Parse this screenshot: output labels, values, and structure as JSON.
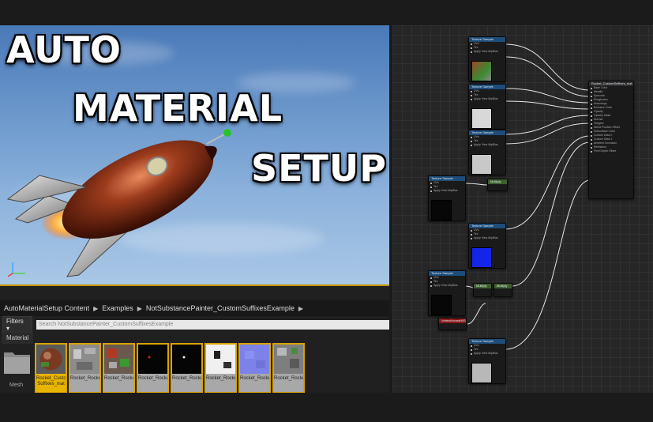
{
  "title_lines": [
    "AUTO",
    "MATERIAL",
    "SETUP"
  ],
  "breadcrumb": [
    "AutoMaterialSetup Content",
    "Examples",
    "NotSubstancePainter_CustomSuffixesExample"
  ],
  "filters_label": "Filters",
  "search_placeholder": "Search NotSubstancePainter_CustomSuffixesExample",
  "filter_category": "Material",
  "folder_label": "Mesh",
  "assets": [
    {
      "label": "Rocket_Custom Suffixes_mat",
      "thumb": "sphere-material",
      "selected": true
    },
    {
      "label": "Rocket_Rocket_mat_ao",
      "thumb": "grey-noise"
    },
    {
      "label": "Rocket_Rocket_mat_DIFF",
      "thumb": "diffuse"
    },
    {
      "label": "Rocket_Rocket_mat_e",
      "thumb": "black-red"
    },
    {
      "label": "Rocket_Rocket_mat_height",
      "thumb": "black-white"
    },
    {
      "label": "Rocket_Rocket_mat_metal",
      "thumb": "white-black"
    },
    {
      "label": "Rocket_Rocket_mat_NORM",
      "thumb": "normal-blue"
    },
    {
      "label": "Rocket_Rocket_mat_r",
      "thumb": "grey-noise"
    }
  ],
  "graph": {
    "texture_node_title": "Texture Sample",
    "multiply_label": "Multiply",
    "vertex_normal_label": "VertexNormalWS",
    "result_node_title": "Rocket_CustomSuffixes_mat",
    "texture_pins": [
      "UVs",
      "Tex",
      "Apply View MipBias"
    ],
    "result_pins": [
      "Base Color",
      "Metallic",
      "Specular",
      "Roughness",
      "Anisotropy",
      "Emissive Color",
      "Opacity",
      "Opacity Mask",
      "Normal",
      "Tangent",
      "World Position Offset",
      "Subsurface Color",
      "Custom Data 0",
      "Custom Data 1",
      "Ambient Occlusion",
      "Refraction",
      "Pixel Depth Offset"
    ]
  },
  "colors": {
    "accent": "#d9a400",
    "node_header": "#1d4d7a",
    "viewport_sky": "#6c98cc"
  }
}
